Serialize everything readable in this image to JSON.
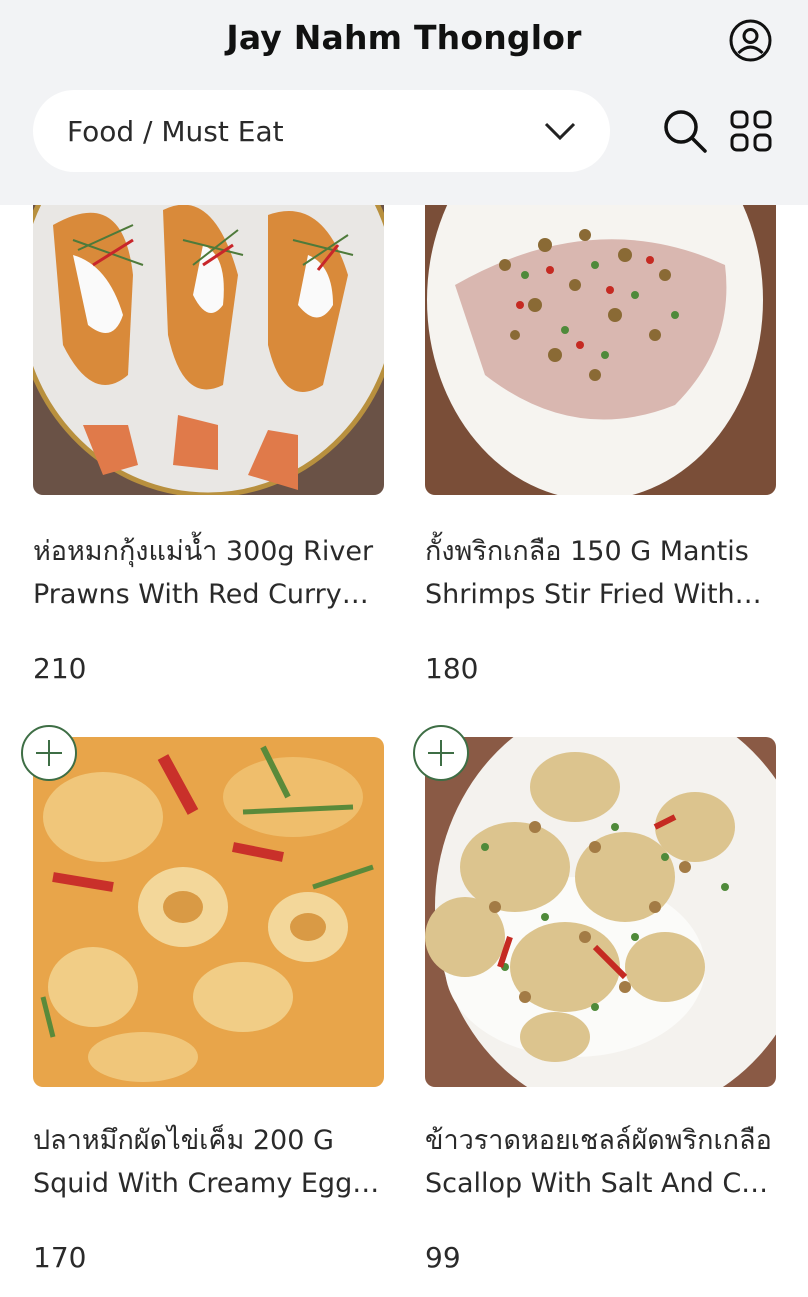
{
  "header": {
    "title": "Jay Nahm Thonglor",
    "category": "Food / Must Eat"
  },
  "icons": {
    "account": "user-circle-icon",
    "search": "search-icon",
    "grid": "grid-view-icon",
    "dropdown": "chevron-down-icon",
    "add": "plus-circle-icon"
  },
  "colors": {
    "header_bg": "#f2f3f5",
    "accent_green": "#3e6e45"
  },
  "items": [
    {
      "name": "ห่อหมกกุ้งแม่น้ำ 300g River Prawns With Red Curry Custard",
      "price": "210"
    },
    {
      "name": "กั้งพริกเกลือ 150 G Mantis Shrimps Stir Fried With Chili And Salt",
      "price": "180"
    },
    {
      "name": "ปลาหมึกผัดไข่เค็ม 200 G Squid With Creamy Egg Yolk",
      "price": "170"
    },
    {
      "name": "ข้าวราดหอยเชลล์ผัดพริกเกลือ Scallop With Salt And Chili On Rice",
      "price": "99"
    }
  ]
}
